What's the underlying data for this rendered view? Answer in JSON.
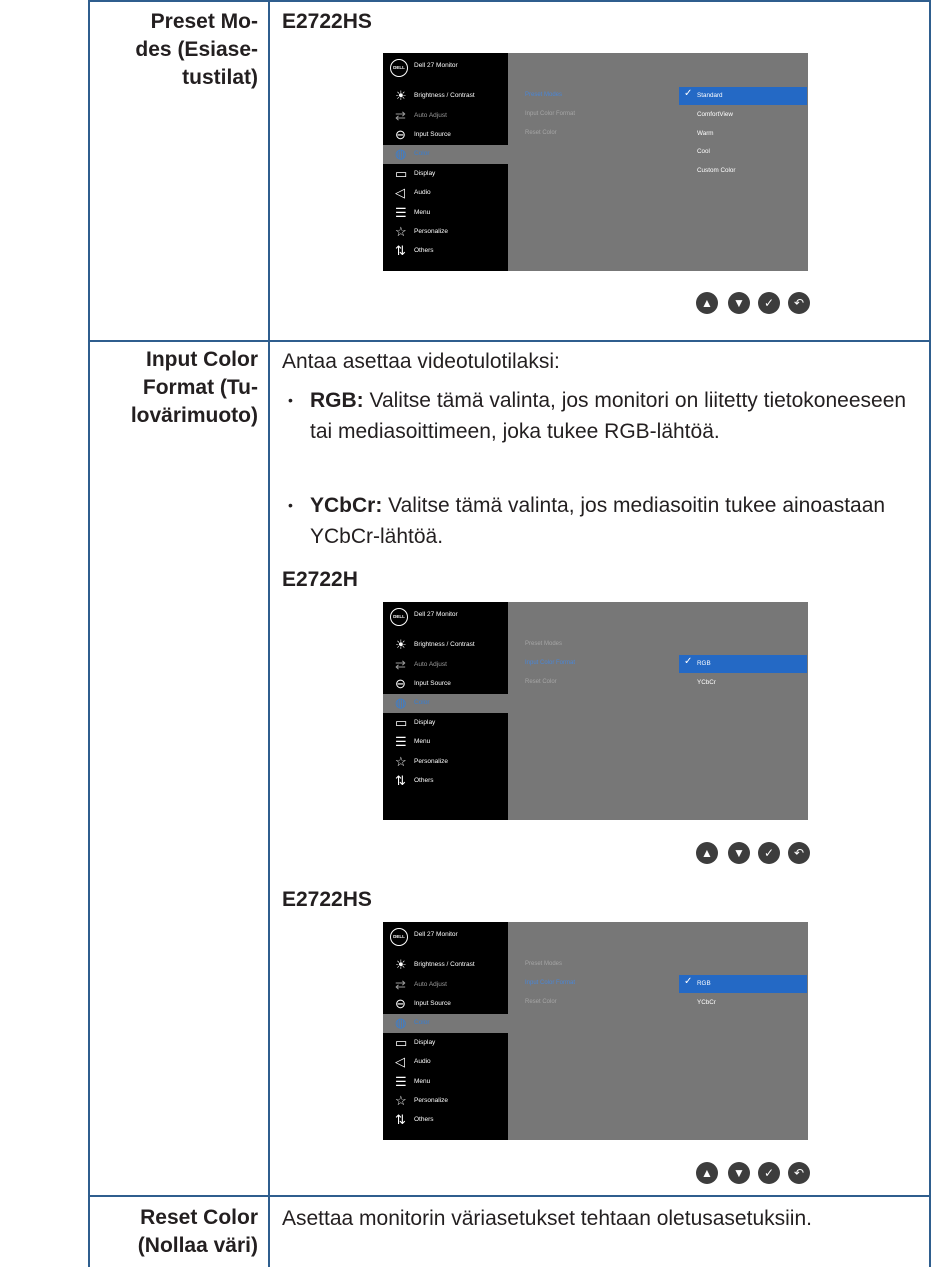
{
  "rows": {
    "preset": {
      "label": "Preset Mo-\ndes (Esiase-\ntustilat)",
      "model": "E2722HS"
    },
    "input_color": {
      "label": "Input Color\nFormat (Tu-\nlovärimuoto)",
      "intro": "Antaa asettaa videotulotilaksi:",
      "bullet1": {
        "term": "RGB:",
        "text": " Valitse tämä valinta, jos monitori on liitetty tietokoneeseen tai mediasoittimeen, joka tukee RGB-lähtöä."
      },
      "bullet2": {
        "term": "YCbCr:",
        "text": " Valitse tämä valinta, jos mediasoitin tukee ainoastaan YCbCr-lähtöä."
      },
      "model_a": "E2722H",
      "model_b": "E2722HS"
    },
    "reset": {
      "label": "Reset Color\n(Nollaa väri)",
      "text": "Asettaa monitorin väriasetukset tehtaan oletusasetuksiin."
    }
  },
  "osd": {
    "header": "Dell 27 Monitor",
    "logo": "DELL",
    "menu_hs": [
      "Brightness / Contrast",
      "Auto Adjust",
      "Input Source",
      "Color",
      "Display",
      "Audio",
      "Menu",
      "Personalize",
      "Others"
    ],
    "menu_h": [
      "Brightness / Contrast",
      "Auto Adjust",
      "Input Source",
      "Color",
      "Display",
      "Menu",
      "Personalize",
      "Others"
    ],
    "submenu": [
      "Preset Modes",
      "Input Color Format",
      "Reset Color"
    ],
    "preset_options": [
      "Standard",
      "ComfortView",
      "Warm",
      "Cool",
      "Custom Color"
    ],
    "format_options": [
      "RGB",
      "YCbCr"
    ]
  },
  "icons": {
    "brightness": "☀",
    "auto": "⇄",
    "input": "⊖",
    "color": "◍",
    "display": "▭",
    "audio": "◁",
    "menu": "☰",
    "personalize": "☆",
    "others": "⇅",
    "up": "▲",
    "down": "▼",
    "ok": "✓",
    "back": "↶",
    "check": "✓"
  }
}
